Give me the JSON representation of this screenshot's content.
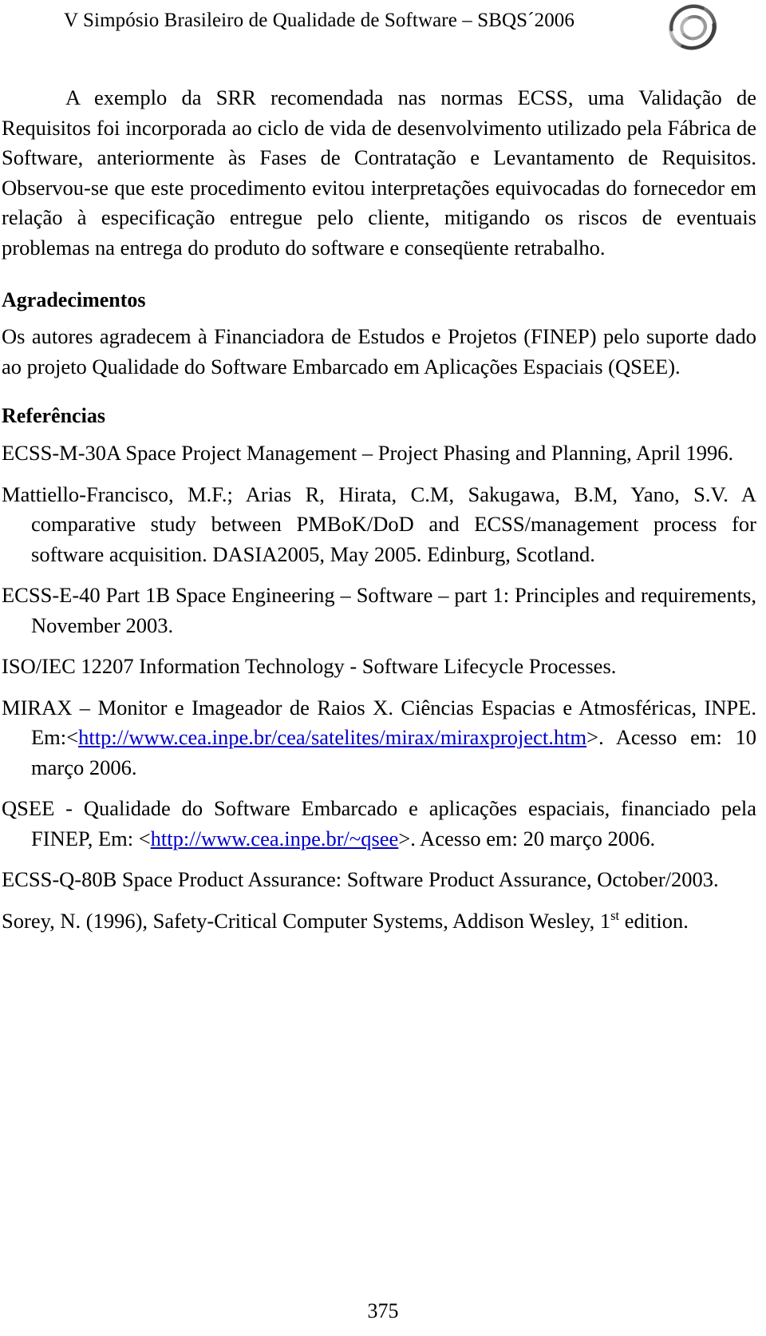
{
  "header": {
    "title": "V Simpósio Brasileiro de Qualidade de Software – SBQS´2006",
    "logo_icon": "swirl-circle-logo"
  },
  "body": {
    "paragraph_1": "A exemplo da SRR recomendada nas normas ECSS, uma Validação de Requisitos foi incorporada ao ciclo de vida de desenvolvimento utilizado pela Fábrica de Software, anteriormente às Fases de Contratação e Levantamento de Requisitos. Observou-se que este procedimento evitou interpretações equivocadas do fornecedor em relação à especificação entregue pelo cliente, mitigando os riscos de eventuais problemas na entrega do produto do software e conseqüente retrabalho."
  },
  "acknowledgements": {
    "heading": "Agradecimentos",
    "text": "Os autores agradecem à Financiadora de Estudos e Projetos (FINEP) pelo suporte dado ao projeto Qualidade do Software Embarcado em Aplicações Espaciais (QSEE)."
  },
  "references": {
    "heading": "Referências",
    "items": [
      {
        "id": "ref-ecss-m-30a",
        "text": "ECSS-M-30A Space Project Management – Project Phasing and Planning, April 1996."
      },
      {
        "id": "ref-mattiello-francisco",
        "text": "Mattiello-Francisco, M.F.; Arias R, Hirata, C.M, Sakugawa, B.M, Yano, S.V. A comparative study between PMBoK/DoD and ECSS/management process for software acquisition. DASIA2005, May 2005. Edinburg, Scotland."
      },
      {
        "id": "ref-ecss-e-40",
        "text": "ECSS-E-40 Part 1B Space Engineering – Software – part 1: Principles and requirements,  November 2003."
      },
      {
        "id": "ref-iso-iec-12207",
        "text": "ISO/IEC 12207 Information Technology - Software Lifecycle Processes."
      },
      {
        "id": "ref-mirax",
        "text_before_url": "MIRAX – Monitor e Imageador de Raios X. Ciências Espacias e Atmosféricas, INPE. Em:<",
        "url": "http://www.cea.inpe.br/cea/satelites/mirax/miraxproject.htm",
        "text_after_url": ">. Acesso em: 10 março 2006."
      },
      {
        "id": "ref-qsee",
        "text_before_url": "QSEE - Qualidade do Software Embarcado e  aplicações espaciais, financiado pela FINEP, Em: <",
        "url": "http://www.cea.inpe.br/~qsee",
        "text_after_url": ">. Acesso em: 20 março 2006."
      },
      {
        "id": "ref-ecss-q-80b",
        "text": "ECSS-Q-80B Space Product Assurance: Software Product Assurance, October/2003."
      },
      {
        "id": "ref-sorey",
        "text_before_sup": "Sorey, N. (1996), Safety-Critical Computer Systems, Addison Wesley, 1",
        "sup": "st",
        "text_after_sup": " edition."
      }
    ]
  },
  "footer": {
    "page_number": "375"
  },
  "colors": {
    "text": "#000000",
    "link": "#0000cc",
    "background": "#ffffff"
  }
}
